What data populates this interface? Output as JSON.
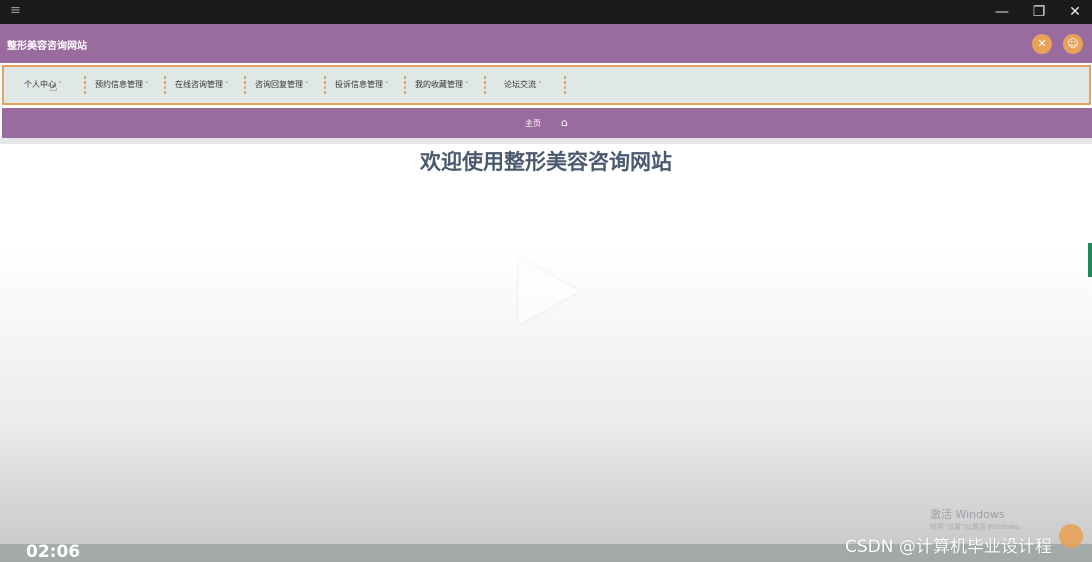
{
  "window": {
    "menu_glyph": "≡",
    "minimize_glyph": "—",
    "restore_glyph": "❐",
    "close_glyph": "✕"
  },
  "header": {
    "site_title": "整形美容咨询网站",
    "fullscreen_icon": "expand-icon",
    "user_icon": "user-icon",
    "accent_color": "#9a6b9e",
    "button_color": "#e8a25a"
  },
  "nav": {
    "items": [
      {
        "label": "个人中心"
      },
      {
        "label": "预约信息管理"
      },
      {
        "label": "在线咨询管理"
      },
      {
        "label": "咨询回复管理"
      },
      {
        "label": "投诉信息管理"
      },
      {
        "label": "我的收藏管理"
      },
      {
        "label": "论坛交流"
      }
    ],
    "caret": "˅"
  },
  "breadcrumb": {
    "home_label": "主页",
    "home_icon": "home-icon"
  },
  "main": {
    "welcome": "欢迎使用整形美容咨询网站"
  },
  "video": {
    "timestamp": "02:06",
    "activate_title": "激活 Windows",
    "activate_sub": "转到\"设置\"以激活 Windows。",
    "watermark": "CSDN @计算机毕业设计程"
  }
}
